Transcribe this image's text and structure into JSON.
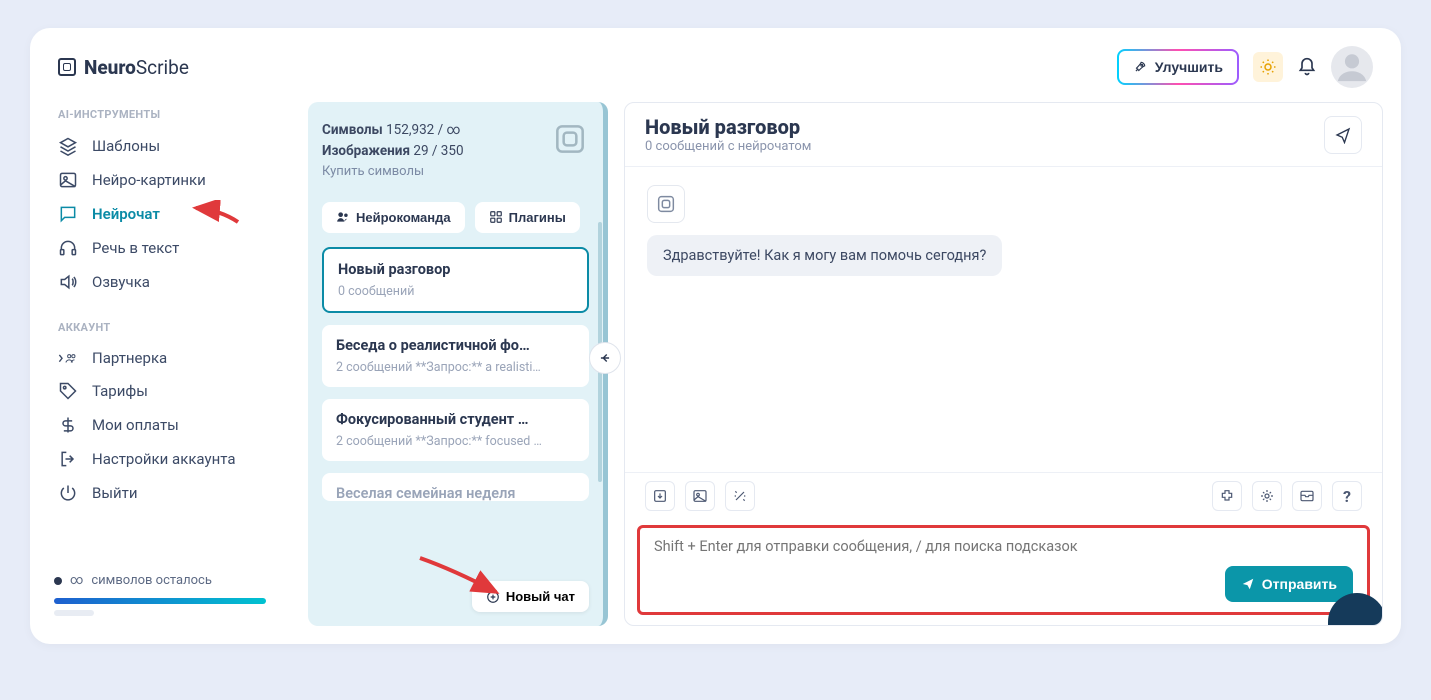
{
  "logo": {
    "bold": "Neuro",
    "light": "Scribe"
  },
  "header": {
    "upgrade": "Улучшить"
  },
  "sidebar": {
    "section1": "AI-ИНСТРУМЕНТЫ",
    "items1": [
      {
        "label": "Шаблоны"
      },
      {
        "label": "Нейро-картинки"
      },
      {
        "label": "Нейрочат"
      },
      {
        "label": "Речь в текст"
      },
      {
        "label": "Озвучка"
      }
    ],
    "section2": "АККАУНТ",
    "items2": [
      {
        "label": "Партнерка"
      },
      {
        "label": "Тарифы"
      },
      {
        "label": "Мои оплаты"
      },
      {
        "label": "Настройки аккаунта"
      },
      {
        "label": "Выйти"
      }
    ],
    "remaining_prefix": "∞",
    "remaining": "символов осталось"
  },
  "conv": {
    "symbols_label": "Символы",
    "symbols_value": "152,932 / ∞",
    "images_label": "Изображения",
    "images_value": "29 / 350",
    "buy": "Купить символы",
    "btn1": "Нейрокоманда",
    "btn2": "Плагины",
    "new_chat": "Новый чат",
    "cards": [
      {
        "title": "Новый разговор",
        "sub": "0 сообщений"
      },
      {
        "title": "Беседа о реалистичной фо…",
        "sub": "2 сообщений    **Запрос:** a realisti…"
      },
      {
        "title": "Фокусированный студент …",
        "sub": "2 сообщений    **Запрос:** focused …"
      },
      {
        "title": "Веселая семейная неделя"
      }
    ]
  },
  "chat": {
    "title": "Новый разговор",
    "subtitle": "0 сообщений с нейрочатом",
    "greeting": "Здравствуйте! Как я могу вам помочь сегодня?",
    "placeholder": "Shift + Enter для отправки сообщения, / для поиска подсказок",
    "send": "Отправить"
  }
}
